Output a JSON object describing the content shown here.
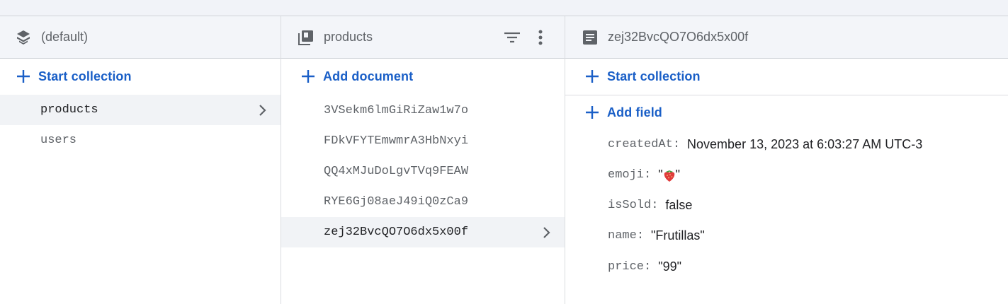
{
  "colors": {
    "accent": "#1a5fc7",
    "header_bg": "#f3f5f9",
    "selected_row": "#f1f3f6"
  },
  "databases": {
    "title": "(default)",
    "icon": "database-stack-icon",
    "action_label": "Start collection",
    "collections": [
      {
        "name": "products",
        "selected": true
      },
      {
        "name": "users",
        "selected": false
      }
    ]
  },
  "collection": {
    "title": "products",
    "icon": "collection-icon",
    "filter_icon": "filter-icon",
    "more_icon": "more-vert-icon",
    "action_label": "Add document",
    "documents": [
      {
        "id": "3VSekm6lmGiRiZaw1w7o",
        "selected": false
      },
      {
        "id": "FDkVFYTEmwmrA3HbNxyi",
        "selected": false
      },
      {
        "id": "QQ4xMJuDoLgvTVq9FEAW",
        "selected": false
      },
      {
        "id": "RYE6Gj08aeJ49iQ0zCa9",
        "selected": false
      },
      {
        "id": "zej32BvcQO7O6dx5x00f",
        "selected": true
      }
    ]
  },
  "document": {
    "title": "zej32BvcQO7O6dx5x00f",
    "icon": "document-icon",
    "start_collection_label": "Start collection",
    "add_field_label": "Add field",
    "fields": [
      {
        "key": "createdAt",
        "value": "November 13, 2023 at 6:03:27 AM UTC-3"
      },
      {
        "key": "emoji",
        "value": "🍓",
        "type": "emoji"
      },
      {
        "key": "isSold",
        "value": "false"
      },
      {
        "key": "name",
        "value": "\"Frutillas\""
      },
      {
        "key": "price",
        "value": "\"99\""
      }
    ]
  }
}
